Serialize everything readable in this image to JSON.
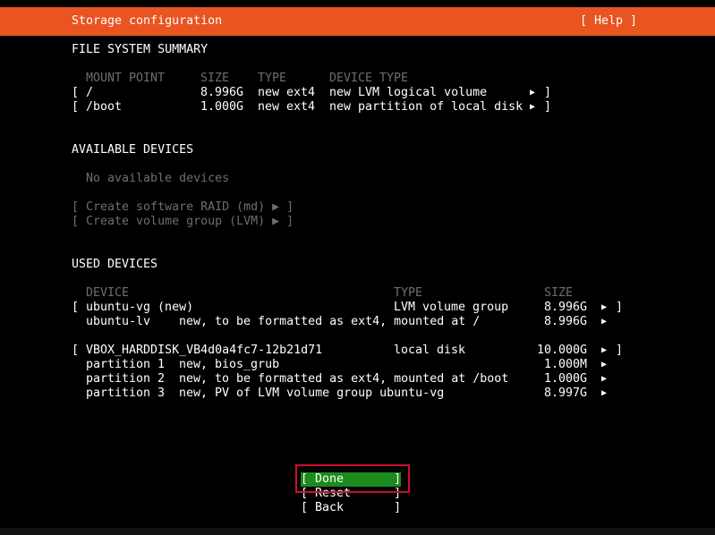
{
  "header": {
    "title": "Storage configuration",
    "help": "[ Help ]"
  },
  "fs": {
    "title": "FILE SYSTEM SUMMARY",
    "columns": {
      "mount": "MOUNT POINT",
      "size": "SIZE",
      "type": "TYPE",
      "device_type": "DEVICE TYPE"
    },
    "rows": [
      {
        "mount": "/",
        "size": "8.996G",
        "type": "new ext4",
        "device_type": "new LVM logical volume"
      },
      {
        "mount": "/boot",
        "size": "1.000G",
        "type": "new ext4",
        "device_type": "new partition of local disk"
      }
    ]
  },
  "available": {
    "title": "AVAILABLE DEVICES",
    "empty": "No available devices",
    "actions": [
      "[ Create software RAID (md) ▶ ]",
      "[ Create volume group (LVM) ▶ ]"
    ]
  },
  "used": {
    "title": "USED DEVICES",
    "columns": {
      "device": "DEVICE",
      "type": "TYPE",
      "size": "SIZE"
    },
    "vg": {
      "name": "ubuntu-vg (new)",
      "type": "LVM volume group",
      "size": "8.996G"
    },
    "lv": {
      "name": "ubuntu-lv",
      "detail": "new, to be formatted as ext4, mounted at /",
      "size": "8.996G"
    },
    "disk": {
      "name": "VBOX_HARDDISK_VB4d0a4fc7-12b21d71",
      "type": "local disk",
      "size": "10.000G"
    },
    "partitions": [
      {
        "name": "partition 1",
        "detail": "new, bios_grub",
        "size": "1.000M"
      },
      {
        "name": "partition 2",
        "detail": "new, to be formatted as ext4, mounted at /boot",
        "size": "1.000G"
      },
      {
        "name": "partition 3",
        "detail": "new, PV of LVM volume group ubuntu-vg",
        "size": "8.997G"
      }
    ]
  },
  "glyphs": {
    "open": "[",
    "close": "]",
    "arrow": "▶"
  },
  "buttons": {
    "done": "[ Done       ]",
    "reset": "[ Reset      ]",
    "back": "[ Back       ]"
  },
  "colors": {
    "accent": "#e95420",
    "focus": "#1c8a1c",
    "highlight_outline": "#c8102e",
    "disabled": "#6e6e6e"
  }
}
